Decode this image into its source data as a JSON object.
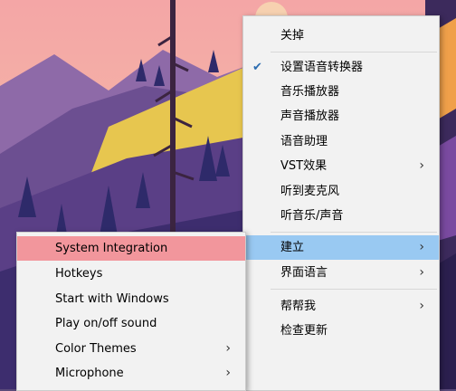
{
  "main_menu": {
    "close": "关掉",
    "set_voice_changer": "设置语音转换器",
    "music_player": "音乐播放器",
    "sound_player": "声音播放器",
    "voice_assistant": "语音助理",
    "vst_effects": "VST效果",
    "hear_microphone": "听到麦克风",
    "hear_music_sound": "听音乐/声音",
    "build": "建立",
    "interface_language": "界面语言",
    "help_me": "帮帮我",
    "check_updates": "检查更新"
  },
  "sub_menu": {
    "system_integration": "System Integration",
    "hotkeys": "Hotkeys",
    "start_with_windows": "Start with Windows",
    "play_onoff_sound": "Play on/off sound",
    "color_themes": "Color Themes",
    "microphone": "Microphone"
  },
  "glyphs": {
    "chevron": "›",
    "check": "✔"
  },
  "colors": {
    "menu_bg": "#f2f2f2",
    "highlight_blue": "#99c9f2",
    "highlight_red": "#f2969c",
    "check_blue": "#2b6cb0"
  }
}
